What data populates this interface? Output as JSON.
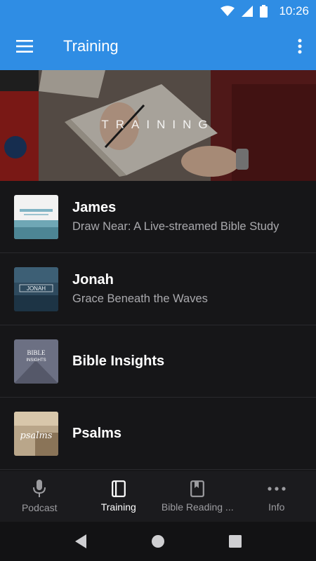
{
  "status": {
    "time": "10:26"
  },
  "appbar": {
    "title": "Training"
  },
  "hero": {
    "label": "TRAINING"
  },
  "items": [
    {
      "title": "James",
      "subtitle": "Draw Near: A Live-streamed Bible Study",
      "thumb_text": "DRAW NEAR"
    },
    {
      "title": "Jonah",
      "subtitle": "Grace Beneath the Waves",
      "thumb_text": "JONAH"
    },
    {
      "title": "Bible Insights",
      "subtitle": "",
      "thumb_text": "BIBLE INSIGHTS"
    },
    {
      "title": "Psalms",
      "subtitle": "",
      "thumb_text": "psalms"
    }
  ],
  "nav": [
    {
      "label": "Podcast",
      "icon": "microphone-icon"
    },
    {
      "label": "Training",
      "icon": "book-icon",
      "active": true
    },
    {
      "label": "Bible Reading ...",
      "icon": "bookmark-book-icon"
    },
    {
      "label": "Info",
      "icon": "more-dots-icon"
    }
  ],
  "colors": {
    "appbar": "#2f8de4",
    "background": "#161618",
    "subtitle": "#a9a9ad"
  }
}
